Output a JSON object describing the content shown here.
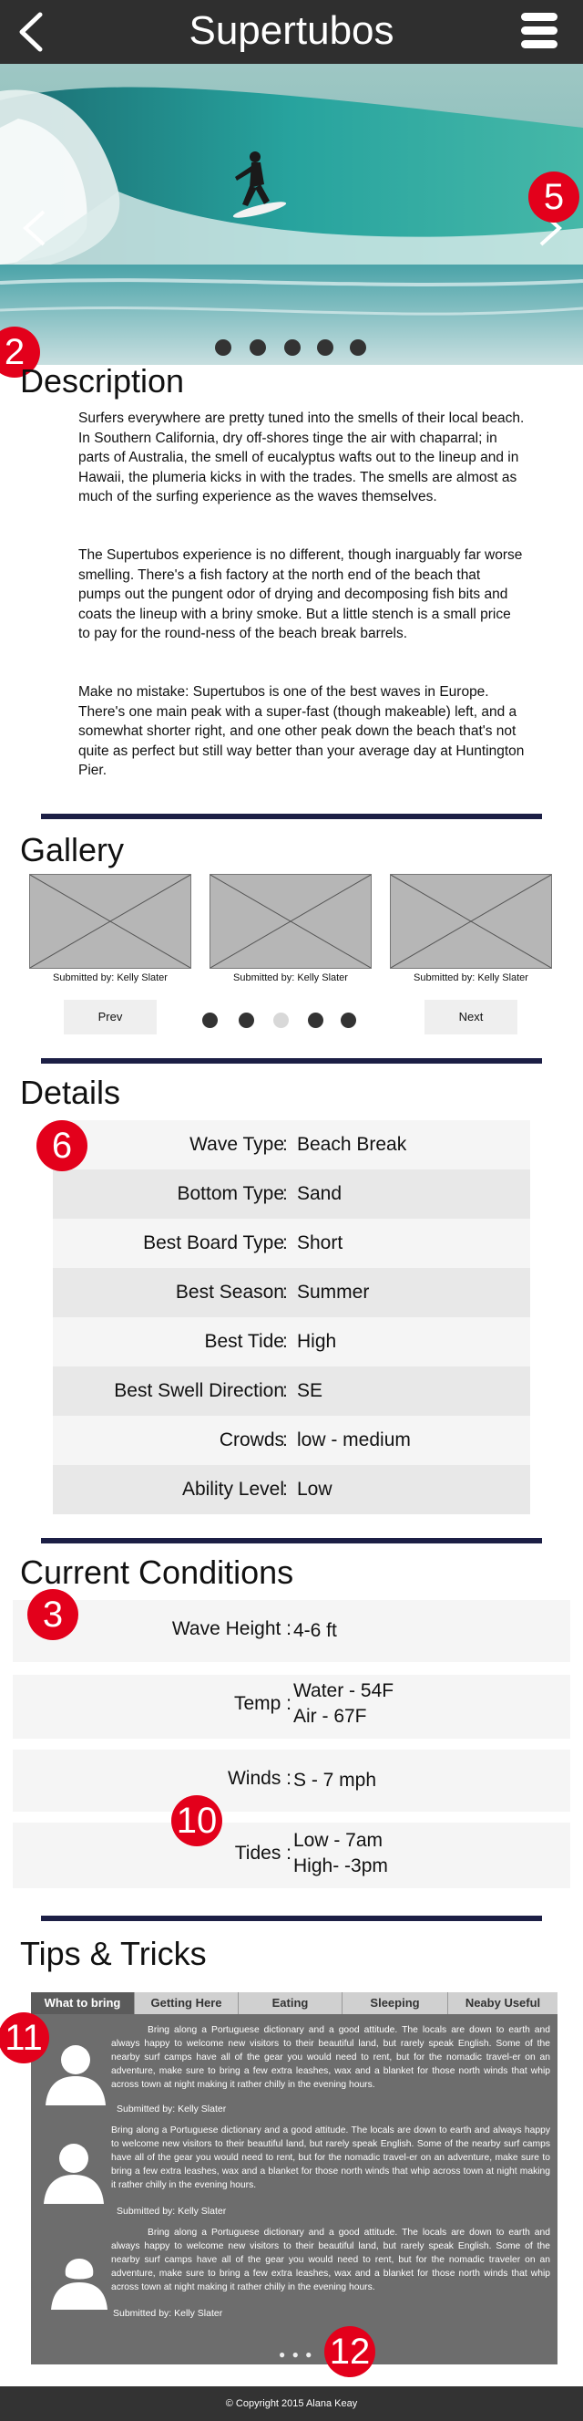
{
  "header": {
    "title": "Supertubos",
    "back_icon": "chevron-left-icon",
    "menu_icon": "hamburger-menu-icon"
  },
  "hero": {
    "prev_icon": "chevron-left-icon",
    "next_icon": "chevron-right-icon",
    "dots": 5,
    "marker": "5"
  },
  "markers": {
    "description": "2",
    "details": "6",
    "conditions": "3",
    "tides": "10",
    "tips": "11",
    "tips_more": "12"
  },
  "description": {
    "heading": "Description",
    "paragraphs": [
      "Surfers everywhere are pretty tuned into the smells of their local beach. In Southern California, dry off-shores tinge the air with chaparral; in parts of Australia, the smell of eucalyptus wafts out to the lineup and in Hawaii, the plumeria kicks in with the trades. The smells are almost as much of the surfing experience as the waves themselves.",
      "The Supertubos experience is no different, though inarguably far worse smelling. There's a fish factory at the north end of the beach that pumps out the pungent odor of drying and decomposing fish bits and coats the lineup with a briny smoke. But a little stench is a small price to pay for the round-ness of the beach break barrels.",
      "Make no mistake: Supertubos is one of the best waves in Europe. There's one main peak with a super-fast (though makeable) left, and a somewhat shorter right, and one other peak down the beach that's not quite as perfect but still way better than your average day at Huntington Pier."
    ]
  },
  "gallery": {
    "heading": "Gallery",
    "items": [
      {
        "caption": "Submitted by: Kelly Slater"
      },
      {
        "caption": "Submitted by: Kelly Slater"
      },
      {
        "caption": "Submitted by: Kelly Slater"
      }
    ],
    "prev_label": "Prev",
    "next_label": "Next",
    "dot_active_index": 2,
    "dot_colors": {
      "active": "#d8d8d8",
      "inactive": "#333333"
    }
  },
  "details": {
    "heading": "Details",
    "rows": [
      {
        "label": "Wave Type",
        "value": "Beach Break"
      },
      {
        "label": "Bottom Type",
        "value": "Sand"
      },
      {
        "label": "Best Board Type",
        "value": "Short"
      },
      {
        "label": "Best Season",
        "value": "Summer"
      },
      {
        "label": "Best Tide",
        "value": "High"
      },
      {
        "label": "Best Swell Direction",
        "value": "SE"
      },
      {
        "label": "Crowds",
        "value": "low - medium"
      },
      {
        "label": "Ability Level",
        "value": "Low"
      }
    ]
  },
  "conditions": {
    "heading": "Current Conditions",
    "wave_height": {
      "label": "Wave Height",
      "value": "4-6 ft"
    },
    "temp": {
      "label": "Temp",
      "water": "Water -  54F",
      "air": "Air - 67F"
    },
    "winds": {
      "label": "Winds",
      "value": "S - 7 mph"
    },
    "tides": {
      "label": "Tides",
      "low": "Low - 7am",
      "high": "High- -3pm"
    }
  },
  "tips": {
    "heading": "Tips & Tricks",
    "tabs": [
      "What to bring",
      "Getting Here",
      "Eating",
      "Sleeping",
      "Neaby Useful"
    ],
    "active_tab": 0,
    "entries": [
      {
        "avatar": "user-avatar-icon",
        "text": "Bring along a Portuguese dictionary and a good attitude. The locals are down to earth and always happy to welcome new visitors to their beautiful land, but rarely speak English. Some of the nearby surf camps have all of the gear you would need to rent, but for the nomadic travel-er on an adventure, make sure to bring a few extra leashes, wax and a blanket for those north winds that whip across town at night making it rather chilly in the evening hours.",
        "submitted": "Submitted by: Kelly Slater"
      },
      {
        "avatar": "user-avatar-icon",
        "text": "Bring along a Portuguese dictionary and a good attitude. The locals are down to earth and always happy to welcome new visitors to their beautiful land, but rarely speak English. Some of the nearby surf camps have all of the gear you would need to rent, but for the nomadic travel-er on an adventure, make sure to bring a few extra leashes, wax and a blanket for those north winds that whip across town at night making it rather chilly in the evening hours.",
        "submitted": "Submitted by: Kelly Slater"
      },
      {
        "avatar": "user-avatar-female-icon",
        "text": "Bring along a Portuguese dictionary and a good attitude. The locals are down to earth and always happy to welcome new visitors to their beautiful land, but rarely speak English. Some of the nearby surf camps have all of the gear you would need to rent, but for the nomadic traveler on an adventure, make sure to bring a few extra leashes, wax and a blanket for those north winds that whip across town at night making it rather chilly in the evening hours.",
        "submitted": "Submitted by: Kelly Slater"
      }
    ],
    "more_label": "● ● ●"
  },
  "footer": {
    "text": "© Copyright 2015 Alana Keay"
  },
  "colors": {
    "header_bg": "#2f2f2f",
    "rule": "#1c1f45",
    "marker": "#e3001b",
    "panel": "#6d6d6d"
  }
}
